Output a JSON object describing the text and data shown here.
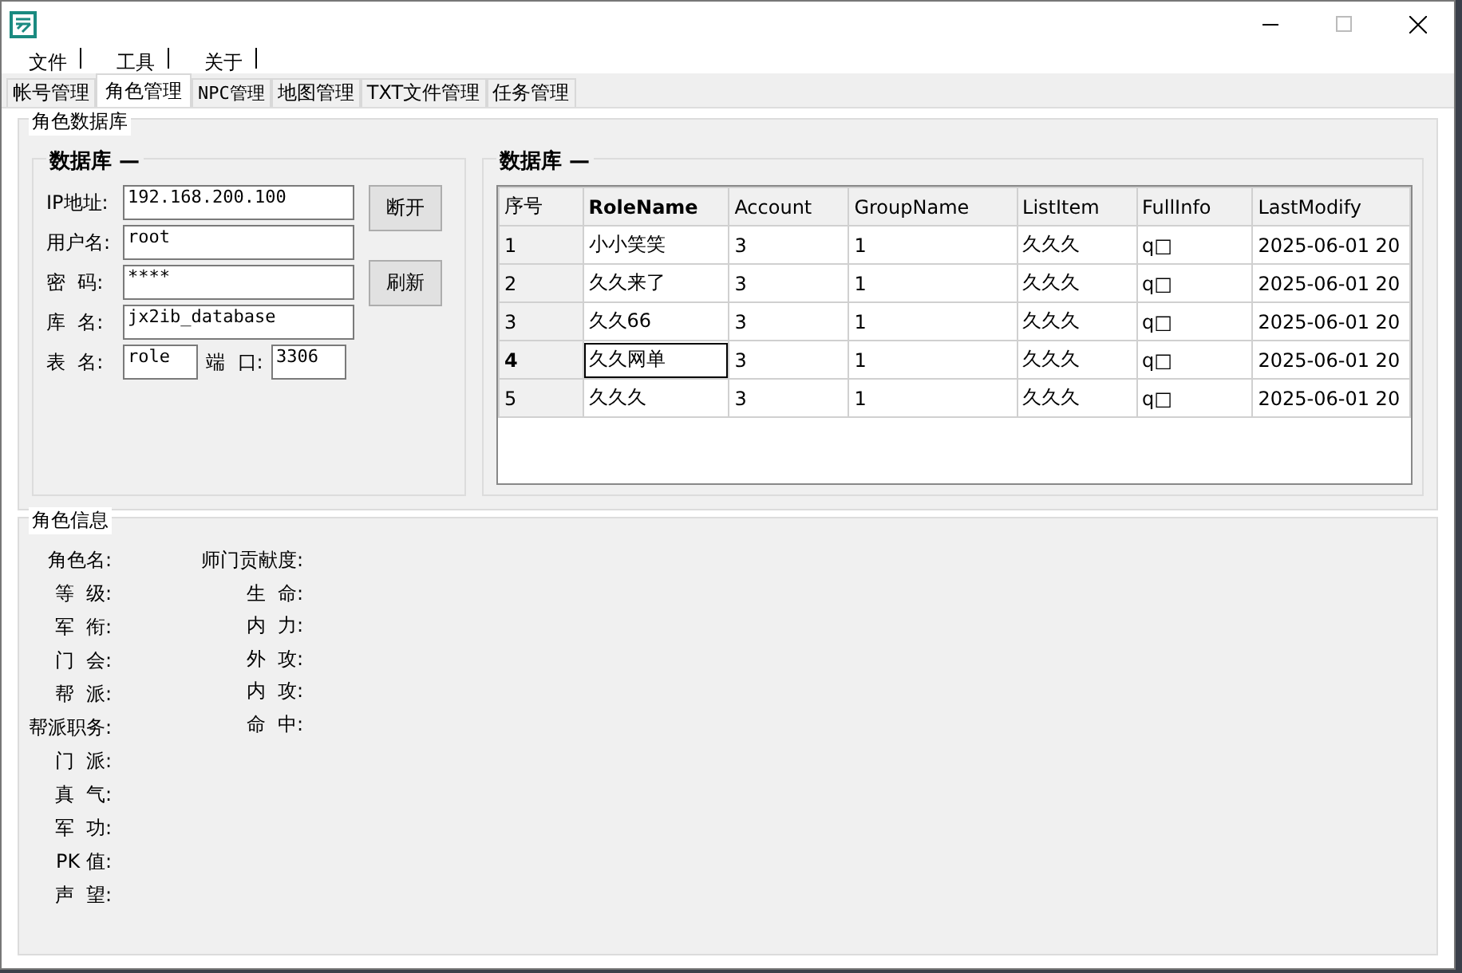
{
  "menu": [
    {
      "label": "文件"
    },
    {
      "label": "工具"
    },
    {
      "label": "关于"
    }
  ],
  "tabs": [
    {
      "label": "帐号管理",
      "selected": false
    },
    {
      "label": "角色管理",
      "selected": true
    },
    {
      "label": "NPC管理",
      "selected": false
    },
    {
      "label": "地图管理",
      "selected": false
    },
    {
      "label": "TXT文件管理",
      "selected": false
    },
    {
      "label": "任务管理",
      "selected": false
    }
  ],
  "db_group": {
    "title": "角色数据库",
    "connection": {
      "title": "数据库 —",
      "fields": [
        {
          "label": "IP地址:",
          "value": "192.168.200.100"
        },
        {
          "label": "用户名:",
          "value": "root"
        },
        {
          "label": "密  码:",
          "value": "****"
        },
        {
          "label": "库  名:",
          "value": "jx2ib_database"
        }
      ],
      "table_field": {
        "label": "表  名:",
        "value": "role"
      },
      "port_field": {
        "label": "端  口:",
        "value": "3306"
      },
      "buttons": [
        "断开",
        "刷新"
      ]
    },
    "grid": {
      "title": "数据库 —",
      "columns": [
        {
          "label": "序号",
          "selected": false
        },
        {
          "label": "RoleName",
          "selected": true
        },
        {
          "label": "Account",
          "selected": false
        },
        {
          "label": "GroupName",
          "selected": false
        },
        {
          "label": "ListItem",
          "selected": false
        },
        {
          "label": "FullInfo",
          "selected": false
        },
        {
          "label": "LastModify",
          "selected": false
        }
      ],
      "rows": [
        {
          "selected": false,
          "cells": [
            "1",
            "小小笑笑",
            "3",
            "1",
            "久久久",
            "q□",
            "2025-06-01 20"
          ]
        },
        {
          "selected": false,
          "cells": [
            "2",
            "久久来了",
            "3",
            "1",
            "久久久",
            "q□",
            "2025-06-01 20"
          ]
        },
        {
          "selected": false,
          "cells": [
            "3",
            "久久66",
            "3",
            "1",
            "久久久",
            "q□",
            "2025-06-01 20"
          ]
        },
        {
          "selected": true,
          "cells": [
            "4",
            "久久网单",
            "3",
            "1",
            "久久久",
            "q□",
            "2025-06-01 20"
          ]
        },
        {
          "selected": false,
          "cells": [
            "5",
            "久久久",
            "3",
            "1",
            "久久久",
            "q□",
            "2025-06-01 20"
          ]
        }
      ]
    }
  },
  "info_group": {
    "title": "角色信息",
    "left_labels": [
      "角色名:",
      "等  级:",
      "军  衔:",
      "门  会:",
      "帮  派:",
      "帮派职务:",
      "门  派:",
      "真  气:",
      "军  功:",
      "PK 值:",
      "声  望:"
    ],
    "right_labels": [
      "师门贡献度:",
      "生  命:",
      "内  力:",
      "外  攻:",
      "内  攻:",
      "命  中:"
    ]
  }
}
